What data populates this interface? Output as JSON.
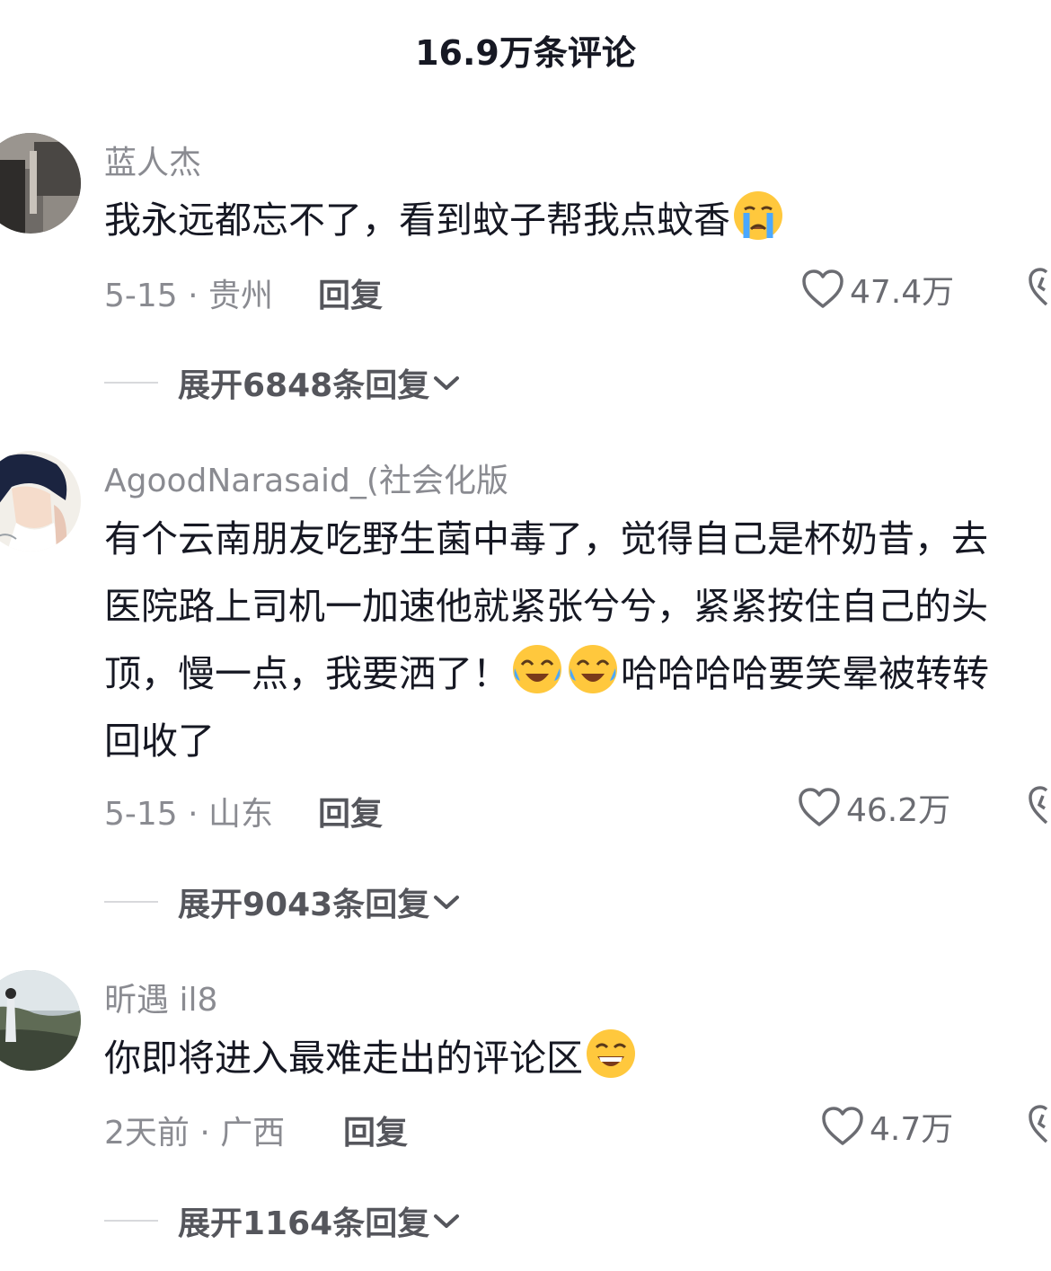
{
  "header": {
    "title": "16.9万条评论"
  },
  "comments": [
    {
      "username": "蓝人杰",
      "lines": [
        [
          "我永远都忘不了，看到蚊子帮我点蚊香",
          "crying-face-emoji"
        ]
      ],
      "date_location": "5-15 · 贵州",
      "reply_label": "回复",
      "likes": "47.4万",
      "expand_label": "展开6848条回复"
    },
    {
      "username": "AgoodNarasaid_(社会化版",
      "lines": [
        [
          "有个云南朋友吃野生菌中毒了，觉得自己是杯奶昔，去"
        ],
        [
          "医院路上司机一加速他就紧张兮兮，紧紧按住自己的头"
        ],
        [
          "顶，慢一点，我要洒了！",
          "laughing-crying-emoji",
          "laughing-crying-emoji",
          "哈哈哈哈要笑晕被转转"
        ],
        [
          "回收了"
        ]
      ],
      "date_location": "5-15 · 山东",
      "reply_label": "回复",
      "likes": "46.2万",
      "expand_label": "展开9043条回复"
    },
    {
      "username": "昕遇 il8",
      "lines": [
        [
          "你即将进入最难走出的评论区",
          "grinning-face-emoji"
        ]
      ],
      "date_location": "2天前 · 广西",
      "reply_label": "回复",
      "likes": "4.7万",
      "expand_label": "展开1164条回复"
    }
  ],
  "colors": {
    "text_primary": "#161823",
    "text_secondary": "#8a8b91",
    "text_action": "#55565c"
  }
}
